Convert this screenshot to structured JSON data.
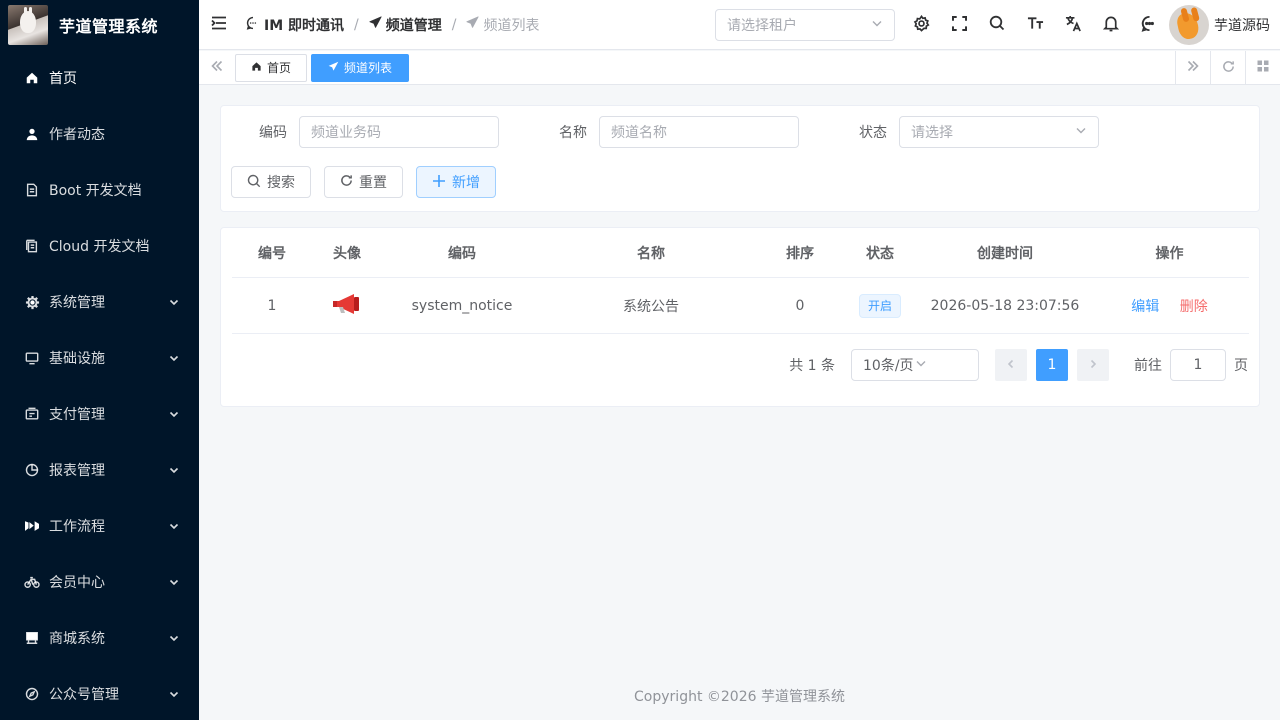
{
  "app": {
    "title": "芋道管理系统"
  },
  "sidebar": {
    "items": [
      {
        "label": "首页",
        "icon": "home-icon",
        "has_arrow": false
      },
      {
        "label": "作者动态",
        "icon": "user-icon",
        "has_arrow": false
      },
      {
        "label": "Boot 开发文档",
        "icon": "document-icon",
        "has_arrow": false
      },
      {
        "label": "Cloud 开发文档",
        "icon": "documents-icon",
        "has_arrow": false
      },
      {
        "label": "系统管理",
        "icon": "gear-icon",
        "has_arrow": true
      },
      {
        "label": "基础设施",
        "icon": "monitor-icon",
        "has_arrow": true
      },
      {
        "label": "支付管理",
        "icon": "wallet-icon",
        "has_arrow": true
      },
      {
        "label": "报表管理",
        "icon": "pie-chart-icon",
        "has_arrow": true
      },
      {
        "label": "工作流程",
        "icon": "workflow-icon",
        "has_arrow": true
      },
      {
        "label": "会员中心",
        "icon": "bicycle-icon",
        "has_arrow": true
      },
      {
        "label": "商城系统",
        "icon": "shop-icon",
        "has_arrow": true
      },
      {
        "label": "公众号管理",
        "icon": "compass-icon",
        "has_arrow": true
      }
    ]
  },
  "header": {
    "breadcrumb": [
      {
        "label": "IM 即时通讯",
        "icon": "chat-icon"
      },
      {
        "label": "频道管理",
        "icon": "send-icon"
      },
      {
        "label": "频道列表",
        "icon": "send-icon"
      }
    ],
    "tenant_placeholder": "请选择租户",
    "user_name": "芋道源码"
  },
  "tags": [
    {
      "label": "首页",
      "icon": "home-icon",
      "active": false
    },
    {
      "label": "频道列表",
      "icon": "send-icon",
      "active": true
    }
  ],
  "search": {
    "code_label": "编码",
    "code_placeholder": "频道业务码",
    "name_label": "名称",
    "name_placeholder": "频道名称",
    "status_label": "状态",
    "status_placeholder": "请选择",
    "search_button": "搜索",
    "reset_button": "重置",
    "add_button": "新增"
  },
  "table": {
    "columns": [
      "编号",
      "头像",
      "编码",
      "名称",
      "排序",
      "状态",
      "创建时间",
      "操作"
    ],
    "rows": [
      {
        "id": "1",
        "avatar_icon": "megaphone-icon",
        "code": "system_notice",
        "name": "系统公告",
        "sort": "0",
        "status": "开启",
        "created_at": "2026-05-18 23:07:56",
        "edit": "编辑",
        "delete": "删除"
      }
    ]
  },
  "pagination": {
    "total": "共 1 条",
    "page_size": "10条/页",
    "current_page": "1",
    "goto_label": "前往",
    "goto_value": "1",
    "page_suffix": "页"
  },
  "footer": {
    "text": "Copyright ©2026 芋道管理系统"
  },
  "colors": {
    "primary": "#409eff",
    "danger": "#f56c6c",
    "sidebar_bg": "#001529"
  }
}
